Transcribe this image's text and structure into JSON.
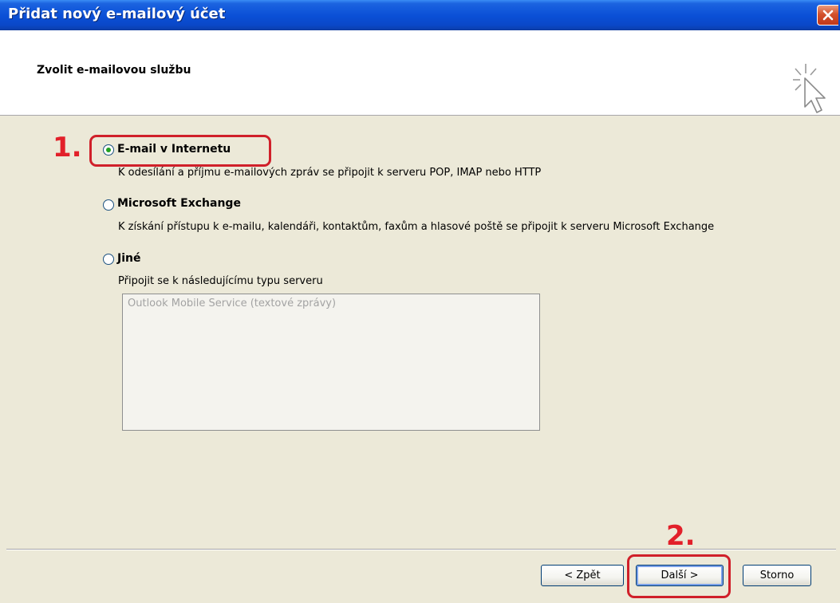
{
  "window": {
    "title": "Přidat nový e-mailový účet"
  },
  "header": {
    "title": "Zvolit e-mailovou službu",
    "icon": "wizard-cursor-icon"
  },
  "options": [
    {
      "label": "E-mail v Internetu",
      "description": "K odesílání a příjmu e-mailových zpráv se připojit k serveru POP, IMAP nebo HTTP",
      "selected": true
    },
    {
      "label": "Microsoft Exchange",
      "description": "K získání přístupu k e-mailu, kalendáři, kontaktům, faxům a hlasové poště se připojit k serveru Microsoft Exchange",
      "selected": false
    },
    {
      "label": "Jiné",
      "description": "Připojit se k následujícímu typu serveru",
      "selected": false
    }
  ],
  "server_list": {
    "items": [
      "Outlook Mobile Service (textové zprávy)"
    ]
  },
  "annotations": {
    "step1": "1.",
    "step2": "2.",
    "color": "#d0202a"
  },
  "buttons": {
    "back": "< Zpět",
    "next": "Další >",
    "cancel": "Storno"
  },
  "colors": {
    "titlebar": "#0a4fd6",
    "dialog_bg": "#ece9d8",
    "radio_dot": "#21a121"
  }
}
